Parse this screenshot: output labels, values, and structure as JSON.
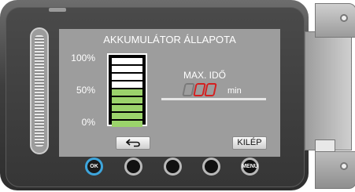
{
  "screen": {
    "title": "AKKUMULÁTOR ÁLLAPOTA",
    "scale": {
      "top": "100%",
      "mid": "50%",
      "bottom": "0%"
    },
    "battery_level_segments": 5,
    "battery_total_segments": 9,
    "max_time_label": "MAX. IDŐ",
    "min_unit": "min",
    "exit_button_label": "KILÉP"
  },
  "buttons": {
    "ok_label": "OK",
    "menu_label": "MENU"
  },
  "colors": {
    "battery_fill": "#9bd36b",
    "segment_empty": "#ffffff",
    "ok_ring": "#3ea6dd",
    "digit_red": "#d42020"
  },
  "icons": {
    "back": "back-arrow-icon",
    "grip": "grip-ridges",
    "screws": "screw-icon"
  }
}
